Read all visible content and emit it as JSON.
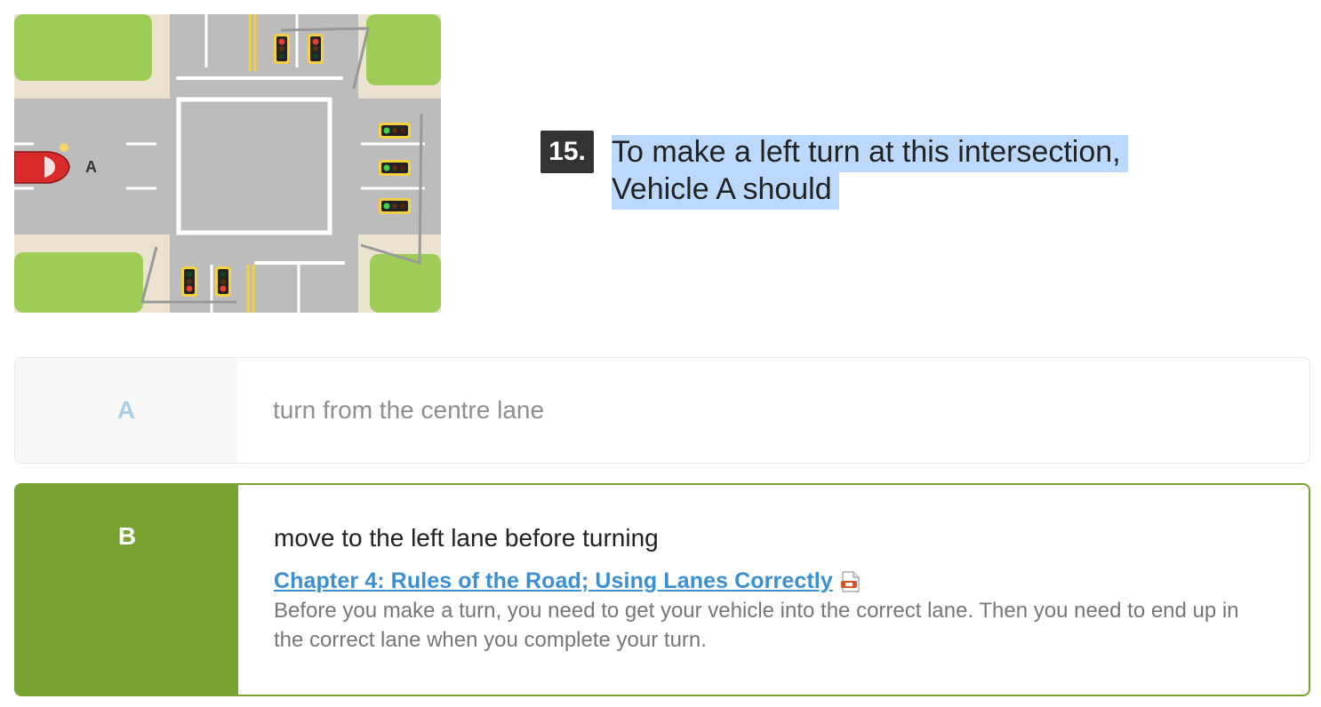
{
  "illustration": {
    "vehicle_label": "A",
    "icon": "intersection-diagram"
  },
  "question": {
    "number": "15.",
    "text": "To make a left turn at this intersection, Vehicle A should"
  },
  "options": [
    {
      "letter": "A",
      "text": "turn from the centre lane",
      "state": "unselected"
    },
    {
      "letter": "B",
      "text": "move to the left lane before turning",
      "state": "correct",
      "link_text": "Chapter 4: Rules of the Road; Using Lanes Correctly",
      "link_icon": "pdf-icon",
      "explanation": "Before you make a turn, you need to get your vehicle into the correct lane. Then you need to end up in the correct lane when you complete your turn."
    }
  ],
  "colors": {
    "correct_green": "#78a22f",
    "highlight": "#bcd9fb",
    "link": "#3b8fd4"
  }
}
